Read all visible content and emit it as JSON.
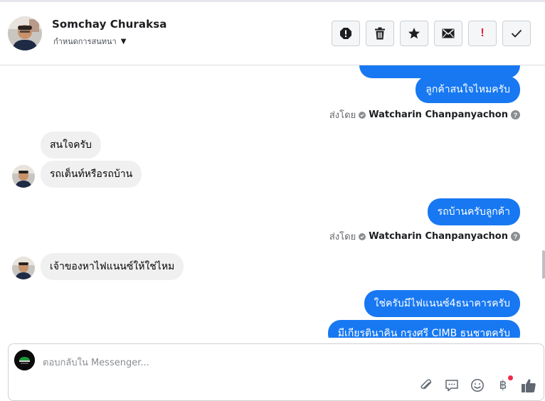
{
  "header": {
    "name": "Somchay Churaksa",
    "sub_label": "กำหนดการสนทนา"
  },
  "actions": [
    {
      "name": "report-icon"
    },
    {
      "name": "trash-icon"
    },
    {
      "name": "star-icon"
    },
    {
      "name": "envelope-icon"
    },
    {
      "name": "exclamation-icon",
      "label": "!"
    },
    {
      "name": "checkmark-icon"
    }
  ],
  "messages": {
    "out_1": "ลูกค้าสนใจไหมครับ",
    "in_1": "สนใจครับ",
    "in_2": "รถเต็นท์หรือรถบ้าน",
    "out_2": "รถบ้านครับลูกค้า",
    "in_3": "เจ้าของหาไฟแนนซ์ให้ใช่ไหม",
    "out_3": "ใช่ครับมีไฟแนนซ์4ธนาคารครับ",
    "out_4": "มีเกียรตินาคิน กรุงศรี CIMB ธนชาตครับ"
  },
  "sent_by": {
    "prefix": "ส่งโดย",
    "agent": "Watcharin Chanpanyachon"
  },
  "composer": {
    "placeholder": "ตอบกลับใน Messenger..."
  },
  "colors": {
    "outgoing_bubble": "#1778f2",
    "incoming_bubble": "#f0f0f0",
    "alert_red": "#e41e3f"
  }
}
